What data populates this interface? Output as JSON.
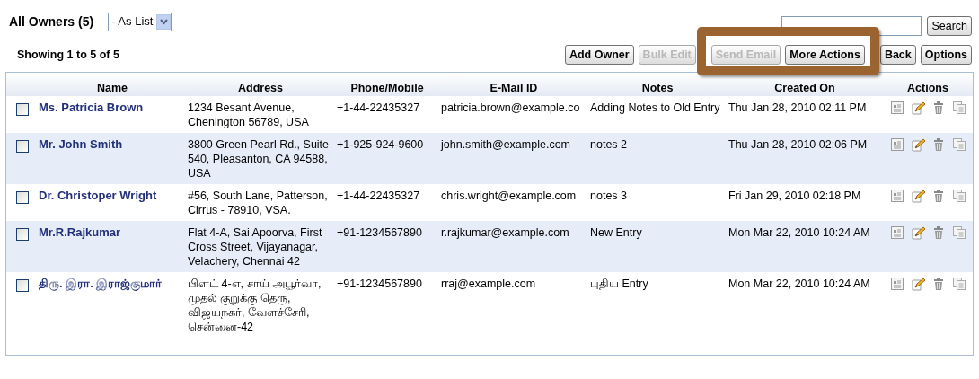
{
  "header": {
    "title": "All Owners (5)",
    "view_select": {
      "value": "- As List"
    }
  },
  "search": {
    "button": "Search"
  },
  "summary": "Showing 1 to 5 of 5",
  "toolbar": [
    {
      "label": "Add Owner",
      "disabled": false
    },
    {
      "label": "Bulk Edit",
      "disabled": true
    },
    {
      "label": "Send Email",
      "disabled": true
    },
    {
      "label": "More Actions",
      "disabled": false
    },
    {
      "label": "Back",
      "disabled": false
    },
    {
      "label": "Options",
      "disabled": false
    }
  ],
  "table": {
    "columns": [
      "Name",
      "Address",
      "Phone/Mobile",
      "E-Mail ID",
      "Notes",
      "Created On",
      "Actions"
    ],
    "rows": [
      {
        "checked": false,
        "name": "Ms. Patricia Brown",
        "address": "1234 Besant Avenue, Chenington 56789, USA",
        "phone": "+1-44-22435327",
        "email": "patricia.brown@example.co",
        "notes": "Adding Notes to Old Entry",
        "created_on": "Thu Jan 28, 2010 02:11 PM"
      },
      {
        "checked": false,
        "name": "Mr. John Smith",
        "address": "3800 Green Pearl Rd., Suite 540, Pleasanton, CA 94588, USA",
        "phone": "+1-925-924-9600",
        "email": "john.smith@example.com",
        "notes": "notes 2",
        "created_on": "Thu Jan 28, 2010 02:06 PM"
      },
      {
        "checked": false,
        "name": "Dr. Christoper Wright",
        "address": "#56, South Lane, Patterson, Cirrus - 78910, VSA.",
        "phone": "+1-44-22435327",
        "email": "chris.wright@example.com",
        "notes": "notes 3",
        "created_on": "Fri Jan 29, 2010 02:18 PM"
      },
      {
        "checked": false,
        "name": "Mr.R.Rajkumar",
        "address": "Flat 4-A, Sai Apoorva, First Cross Street, Vijayanagar, Velachery, Chennai 42",
        "phone": "+91-1234567890",
        "email": "r.rajkumar@example.com",
        "notes": "New Entry",
        "created_on": "Mon Mar 22, 2010 10:24 AM"
      },
      {
        "checked": false,
        "name": "திரு. இரா. இராஜ்குமார்",
        "address": "பிளட் 4-எ, சாய் அபூர்வா, முதல் குறுக்கு தெரு, விஜயநகர், வேளச்சேரி, சென்னை-42",
        "phone": "+91-1234567890",
        "email": "rraj@example.com",
        "notes": "புதிய Entry",
        "created_on": "Mon Mar 22, 2010 10:24 AM"
      }
    ]
  }
}
